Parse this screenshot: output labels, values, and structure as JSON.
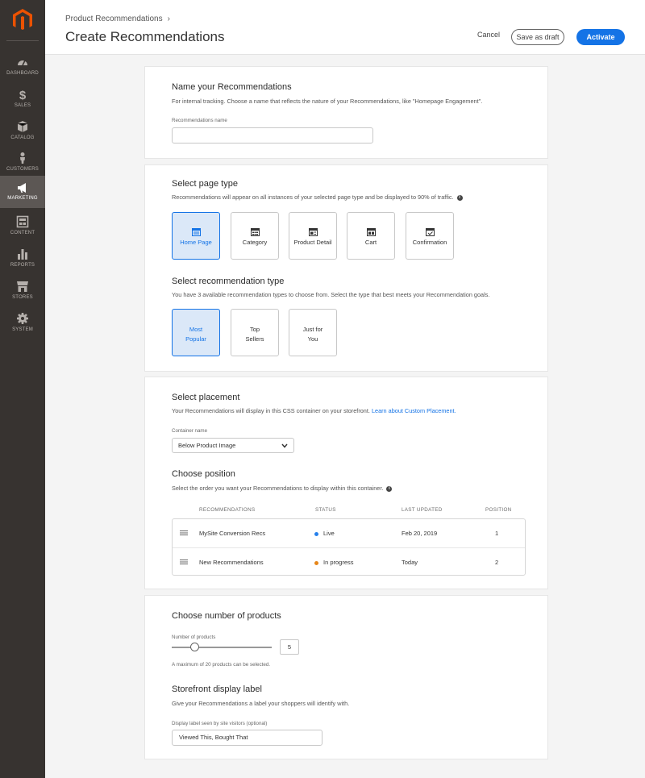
{
  "sidebar": {
    "items": [
      {
        "label": "DASHBOARD",
        "icon": "dashboard-icon"
      },
      {
        "label": "SALES",
        "icon": "dollar-icon"
      },
      {
        "label": "CATALOG",
        "icon": "cube-icon"
      },
      {
        "label": "CUSTOMERS",
        "icon": "person-icon"
      },
      {
        "label": "MARKETING",
        "icon": "megaphone-icon",
        "active": true
      },
      {
        "label": "CONTENT",
        "icon": "layout-icon"
      },
      {
        "label": "REPORTS",
        "icon": "bar-chart-icon"
      },
      {
        "label": "STORES",
        "icon": "storefront-icon"
      },
      {
        "label": "SYSTEM",
        "icon": "gear-icon"
      }
    ]
  },
  "header": {
    "breadcrumb": "Product Recommendations",
    "breadcrumb_sep": "›",
    "title": "Create Recommendations",
    "cancel_label": "Cancel",
    "draft_label": "Save as draft",
    "activate_label": "Activate"
  },
  "name_section": {
    "heading": "Name your Recommendations",
    "description": "For internal tracking. Choose a name that reflects the nature of your Recommendations, like \"Homepage Engagement\".",
    "field_label": "Recommendations name",
    "value": ""
  },
  "page_type": {
    "heading": "Select page type",
    "description": "Recommendations will appear on all instances of your selected page type and be displayed to 90% of traffic.",
    "options": [
      {
        "label": "Home Page",
        "icon": "home-page-icon",
        "selected": true
      },
      {
        "label": "Category",
        "icon": "category-icon",
        "selected": false
      },
      {
        "label": "Product Detail",
        "icon": "product-detail-icon",
        "selected": false
      },
      {
        "label": "Cart",
        "icon": "cart-icon",
        "selected": false
      },
      {
        "label": "Confirmation",
        "icon": "confirmation-icon",
        "selected": false
      }
    ]
  },
  "rec_type": {
    "heading": "Select recommendation type",
    "description": "You have 3 available recommendation types to choose from. Select the type that best meets your Recommendation goals.",
    "options": [
      {
        "line1": "Most",
        "line2": "Popular",
        "selected": true
      },
      {
        "line1": "Top",
        "line2": "Sellers",
        "selected": false
      },
      {
        "line1": "Just for",
        "line2": "You",
        "selected": false
      }
    ]
  },
  "placement": {
    "heading": "Select placement",
    "description": "Your Recommendations will display in this CSS container on your storefront.",
    "link": "Learn about Custom Placement.",
    "container_label": "Container name",
    "container_value": "Below Product Image"
  },
  "position": {
    "heading": "Choose position",
    "description": "Select the order you want your Recommendations to display within this container.",
    "columns": [
      "RECOMMENDATIONS",
      "STATUS",
      "LAST UPDATED",
      "POSITION"
    ],
    "rows": [
      {
        "name": "MySite Conversion Recs",
        "status": "Live",
        "status_color": "#2680eb",
        "updated": "Feb 20, 2019",
        "position": "1"
      },
      {
        "name": "New Recommendations",
        "status": "In progress",
        "status_color": "#e68619",
        "updated": "Today",
        "position": "2"
      }
    ]
  },
  "products": {
    "heading": "Choose number of products",
    "field_label": "Number of products",
    "value": "5",
    "max": 20,
    "hint": "A maximum of 20 products can be selected."
  },
  "display_label": {
    "heading": "Storefront display label",
    "description": "Give your Recommendations a label your shoppers will identify with.",
    "field_label": "Display label seen by site visitors (optional)",
    "value": "Viewed This, Bought That"
  },
  "colors": {
    "accent": "#1473e6",
    "sidebar": "#373330",
    "logo": "#eb5202"
  }
}
